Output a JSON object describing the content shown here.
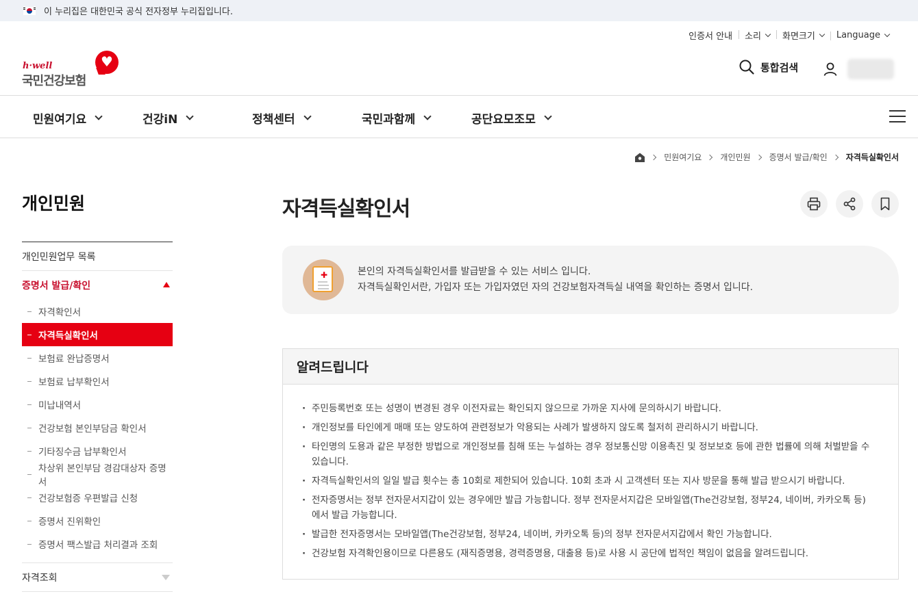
{
  "gov_bar": {
    "text": "이 누리집은 대한민국 공식 전자정부 누리집입니다."
  },
  "utility": {
    "cert": "인증서 안내",
    "sound": "소리",
    "zoom": "화면크기",
    "language": "Language"
  },
  "logo": {
    "brand": "h·well",
    "name": "국민건강보험"
  },
  "header": {
    "search_label": "통합검색"
  },
  "gnb": [
    "민원여기요",
    "건강iN",
    "정책센터",
    "국민과함께",
    "공단요모조모"
  ],
  "breadcrumb": [
    "민원여기요",
    "개인민원",
    "증명서 발급/확인",
    "자격득실확인서"
  ],
  "sidebar": {
    "title": "개인민원",
    "group1": "개인민원업무 목록",
    "group2": "증명서 발급/확인",
    "items": [
      "자격확인서",
      "자격득실확인서",
      "보험료 완납증명서",
      "보험료 납부확인서",
      "미납내역서",
      "건강보험 본인부담금 확인서",
      "기타징수금 납부확인서",
      "차상위 본인부담 경감대상자 증명서",
      "건강보험증 우편발급 신청",
      "증명서 진위확인",
      "증명서 팩스발급 처리결과 조회"
    ],
    "active_index": 1,
    "group3": "자격조회"
  },
  "page": {
    "title": "자격득실확인서"
  },
  "intro": {
    "line1": "본인의 자격득실확인서를 발급받을 수 있는 서비스 입니다.",
    "line2": "자격득실확인서란, 가입자 또는 가입자였던 자의 건강보험자격득실 내역을 확인하는 증명서 입니다."
  },
  "notice": {
    "title": "알려드립니다",
    "items": [
      "주민등록번호 또는 성명이 변경된 경우 이전자료는 확인되지 않으므로 가까운 지사에 문의하시기 바랍니다.",
      "개인정보를 타인에게 매매 또는 양도하여 관련정보가 악용되는 사례가 발생하지 않도록 철저히 관리하시기 바랍니다.",
      "타인명의 도용과 같은 부정한 방법으로 개인정보를 침해 또는 누설하는 경우 정보통신망 이용촉진 및 정보보호 등에 관한 법률에 의해 처벌받을 수 있습니다.",
      "자격득실확인서의 일일 발급 횟수는 총 10회로 제한되어 있습니다. 10회 초과 시 고객센터 또는 지사 방문을 통해 발급 받으시기 바랍니다.",
      "전자증명서는 정부 전자문서지갑이 있는 경우에만 발급 가능합니다. 정부 전자문서지갑은 모바일앱(The건강보험, 정부24, 네이버, 카카오톡 등)에서 발급 가능합니다.",
      "발급한 전자증명서는 모바일앱(The건강보험, 정부24, 네이버, 카카오톡 등)의 정부 전자문서지갑에서 확인 가능합니다.",
      "건강보험 자격확인용이므로 다른용도 (재직증명용, 경력증명용, 대출용 등)로 사용 시 공단에 법적인 책임이 없음을 알려드립니다."
    ]
  },
  "colors": {
    "accent": "#e60012",
    "brand_red": "#c8102e"
  }
}
